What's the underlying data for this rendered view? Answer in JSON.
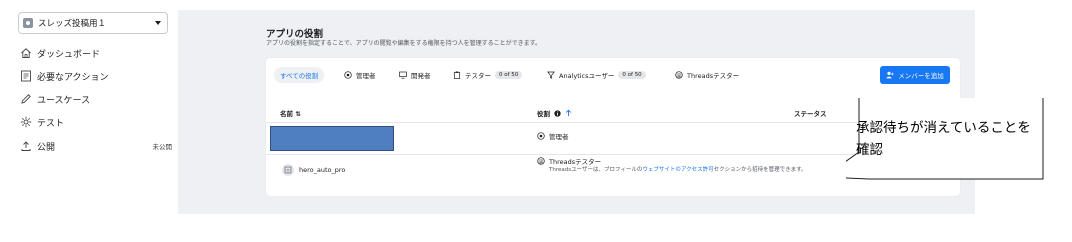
{
  "sidebar": {
    "app_name": "スレッズ投稿用１",
    "items": [
      {
        "label": "ダッシュボード",
        "icon": "home-icon"
      },
      {
        "label": "必要なアクション",
        "icon": "checklist-icon"
      },
      {
        "label": "ユースケース",
        "icon": "pencil-icon"
      },
      {
        "label": "テスト",
        "icon": "gear-icon"
      },
      {
        "label": "公開",
        "icon": "upload-icon",
        "badge": "未公開"
      }
    ]
  },
  "page": {
    "title": "アプリの役割",
    "subtitle": "アプリの役割を指定することで、アプリの閲覧や編集をする権限を持つ人を管理することができます。"
  },
  "tabs": [
    {
      "label": "すべての役割",
      "active": true
    },
    {
      "label": "管理者",
      "icon": "admin-icon"
    },
    {
      "label": "開発者",
      "icon": "monitor-icon"
    },
    {
      "label": "テスター",
      "icon": "clipboard-icon",
      "count": "0 of 50"
    },
    {
      "label": "Analyticsユーザー",
      "icon": "filter-icon",
      "count": "0 of 50"
    },
    {
      "label": "Threadsテスター",
      "icon": "threads-icon"
    }
  ],
  "add_member_button": "メンバーを追加",
  "table": {
    "columns": {
      "name": "名前 ⇅",
      "role": "役割",
      "status": "ステータス"
    },
    "rows": [
      {
        "name": "",
        "role": "管理者",
        "role_icon": "admin-icon"
      },
      {
        "name": "hero_auto_pro",
        "role": "Threadsテスター",
        "role_icon": "threads-icon",
        "desc_pre": "Threadsユーザーは、プロフィールの",
        "desc_link": "ウェブサイトのアクセス許可",
        "desc_post": "セクションから招待を管理できます。"
      }
    ]
  },
  "callout": {
    "text": "承認待ちが消えていることを確認"
  },
  "colors": {
    "accent": "#1877f2",
    "redaction": "#4f7fbf",
    "panel_bg": "#eef0f3"
  }
}
